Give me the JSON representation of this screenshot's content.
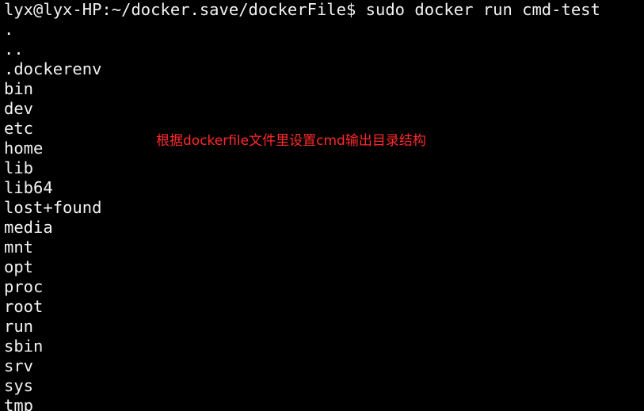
{
  "terminal": {
    "prompt": "lyx@lyx-HP:~/docker.save/dockerFile$ sudo docker run cmd-test",
    "output": [
      ".",
      "..",
      ".dockerenv",
      "bin",
      "dev",
      "etc",
      "home",
      "lib",
      "lib64",
      "lost+found",
      "media",
      "mnt",
      "opt",
      "proc",
      "root",
      "run",
      "sbin",
      "srv",
      "sys",
      "tmp"
    ]
  },
  "annotation": {
    "text": "根据dockerfile文件里设置cmd输出目录结构",
    "color": "#ff2a2a"
  },
  "colors": {
    "background": "#000000",
    "foreground": "#f2f2f2"
  }
}
